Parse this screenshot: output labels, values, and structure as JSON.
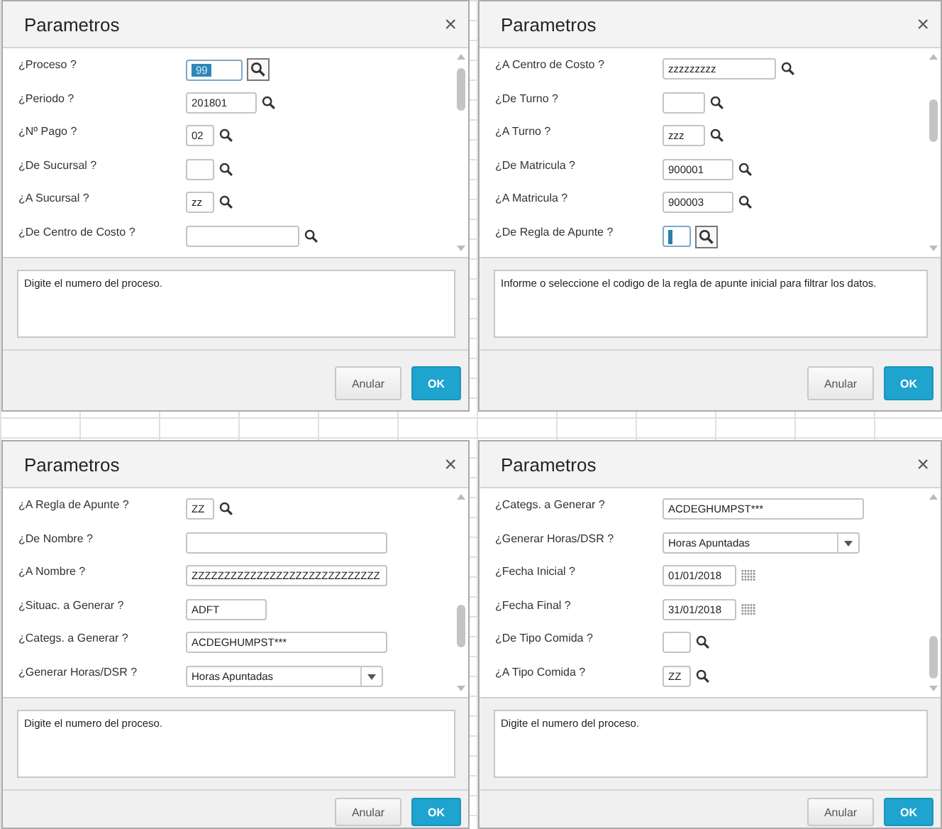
{
  "dialogs": [
    {
      "title": "Parametros",
      "close": "×",
      "fields": [
        {
          "label": "¿Proceso ?",
          "kind": "lookup",
          "value": "99",
          "focused": true
        },
        {
          "label": "¿Periodo ?",
          "kind": "lookup-medium",
          "value": "201801",
          "focused": false
        },
        {
          "label": "¿Nº Pago ?",
          "kind": "lookup-short",
          "value": "02",
          "focused": false
        },
        {
          "label": "¿De Sucursal ?",
          "kind": "lookup-short",
          "focused": false
        },
        {
          "label": "¿A Sucursal ?",
          "kind": "lookup-short",
          "value": "zz",
          "focused": false
        },
        {
          "label": "¿De Centro de Costo ?",
          "kind": "lookup-wide",
          "focused": false
        }
      ],
      "help": "Digite el numero del proceso.",
      "buttons": [
        {
          "label": "Anular",
          "kind": "cancel"
        },
        {
          "label": "OK",
          "kind": "primary"
        }
      ]
    },
    {
      "title": "Parametros",
      "close": "×",
      "fields": [
        {
          "label": "¿A Centro de Costo ?",
          "kind": "lookup-wide",
          "value": "zzzzzzzzz",
          "focused": false
        },
        {
          "label": "¿De Turno ?",
          "kind": "lookup-short2",
          "focused": false
        },
        {
          "label": "¿A Turno ?",
          "kind": "lookup-short2",
          "value": "zzz",
          "focused": false
        },
        {
          "label": "¿De Matricula ?",
          "kind": "lookup-medium",
          "value": "900001",
          "focused": false
        },
        {
          "label": "¿A Matricula ?",
          "kind": "lookup-medium",
          "value": "900003",
          "focused": false
        },
        {
          "label": "¿De Regla de Apunte ?",
          "kind": "lookup-short",
          "focused": true
        }
      ],
      "help": "Informe o seleccione el codigo de la regla de apunte inicial para filtrar los datos.",
      "buttons": [
        {
          "label": "Anular",
          "kind": "cancel"
        },
        {
          "label": "OK",
          "kind": "primary"
        }
      ]
    },
    {
      "title": "Parametros",
      "close": "×",
      "fields": [
        {
          "label": "¿A  Regla de Apunte ?",
          "kind": "lookup-short",
          "value": "ZZ",
          "focused": false
        },
        {
          "label": "¿De Nombre ?",
          "kind": "text-wide",
          "focused": false
        },
        {
          "label": "¿A Nombre ?",
          "kind": "text-wide",
          "value": "ZZZZZZZZZZZZZZZZZZZZZZZZZZZZZ",
          "focused": false
        },
        {
          "label": "¿Situac. a Generar ?",
          "kind": "text-short",
          "value": "ADFT",
          "focused": false
        },
        {
          "label": "¿Categs. a Generar ?",
          "kind": "text-wide",
          "value": "ACDEGHUMPST***",
          "focused": false
        },
        {
          "label": "¿Generar Horas/DSR ?",
          "kind": "select",
          "value": "Horas Apuntadas"
        }
      ],
      "help": "Digite el numero del proceso.",
      "buttons": [
        {
          "label": "Anular",
          "kind": "cancel"
        },
        {
          "label": "OK",
          "kind": "primary"
        }
      ]
    },
    {
      "title": "Parametros",
      "close": "×",
      "fields": [
        {
          "label": "¿Categs. a Generar ?",
          "kind": "text-wide",
          "value": "ACDEGHUMPST***",
          "focused": false
        },
        {
          "label": "¿Generar Horas/DSR ?",
          "kind": "select",
          "value": "Horas Apuntadas"
        },
        {
          "label": "¿Fecha Inicial ?",
          "kind": "date",
          "value": "01/01/2018",
          "focused": false
        },
        {
          "label": "¿Fecha Final ?",
          "kind": "date",
          "value": "31/01/2018",
          "focused": false
        },
        {
          "label": "¿De Tipo Comida ?",
          "kind": "lookup-short",
          "focused": false
        },
        {
          "label": "¿A Tipo Comida ?",
          "kind": "lookup-short",
          "value": "ZZ",
          "focused": false
        }
      ],
      "help": "Digite el numero del proceso.",
      "buttons": [
        {
          "label": "Anular",
          "kind": "cancel"
        },
        {
          "label": "OK",
          "kind": "primary"
        }
      ]
    }
  ]
}
